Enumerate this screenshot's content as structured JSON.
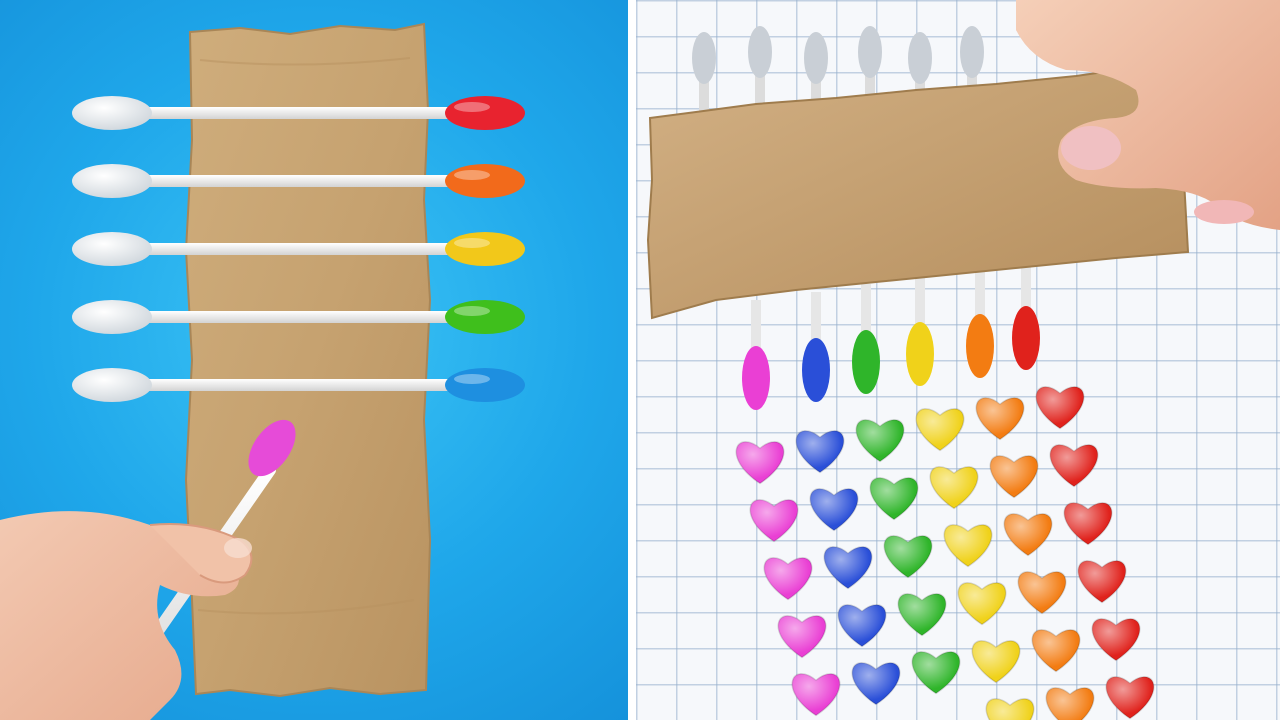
{
  "scene": {
    "left_panel": {
      "background_color": "#1fa7ea",
      "swab_tip_colors": [
        "#e8232f",
        "#f26a1b",
        "#f2c81a",
        "#3fbf1c",
        "#1e8fe0"
      ],
      "brush_tip_color": "#e64bd8",
      "cardboard_color": "#c9a777"
    },
    "right_panel": {
      "background": "grid paper",
      "heart_colors": [
        "#ea3fd4",
        "#2a4fd8",
        "#2fb52a",
        "#f0d21a",
        "#f37c12",
        "#e0221c"
      ],
      "cardboard_color": "#c9a777"
    }
  }
}
